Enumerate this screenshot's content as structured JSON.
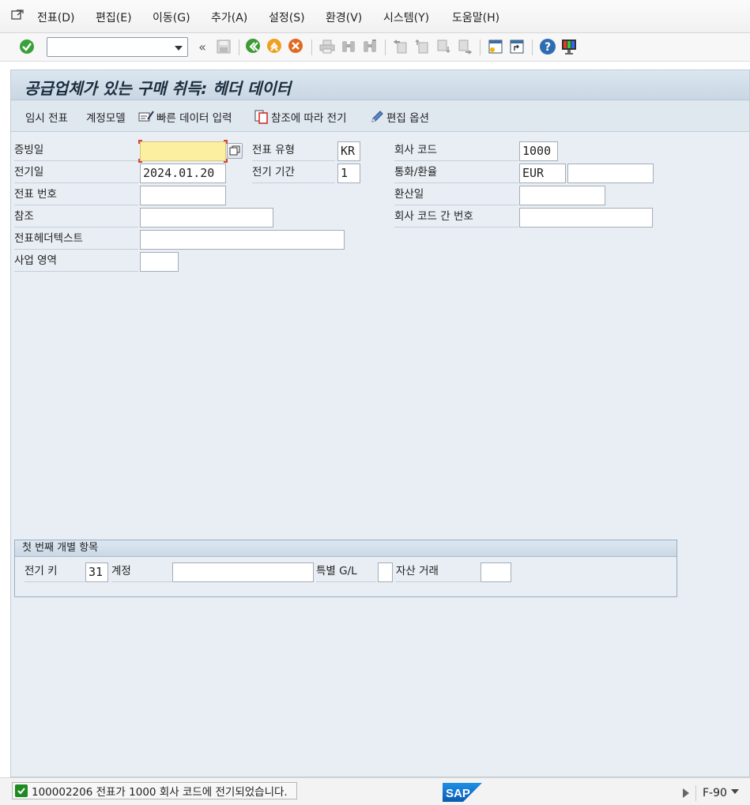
{
  "menu": {
    "items": [
      "전표(D)",
      "편집(E)",
      "이동(G)",
      "추가(A)",
      "설정(S)",
      "환경(V)",
      "시스템(Y)",
      "도움말(H)"
    ]
  },
  "toolbar": {
    "command_value": "",
    "icons": [
      "enter-icon",
      "back-icon",
      "save-icon",
      "back-green-icon",
      "exit-icon",
      "cancel-icon",
      "print-icon",
      "find-icon",
      "find-next-icon",
      "first-page-icon",
      "prev-page-icon",
      "next-page-icon",
      "last-page-icon",
      "new-session-icon",
      "shortcut-icon",
      "help-icon",
      "customize-layout-icon"
    ]
  },
  "screen": {
    "title": "공급업체가 있는 구매 취득: 헤더 데이터"
  },
  "app_toolbar": {
    "buttons": [
      "임시 전표",
      "계정모델",
      "빠른 데이터 입력",
      "참조에 따라 전기",
      "편집 옵션"
    ]
  },
  "header": {
    "doc_date_label": "증빙일",
    "doc_date_value": "",
    "posting_date_label": "전기일",
    "posting_date_value": "2024.01.20",
    "doc_number_label": "전표 번호",
    "doc_number_value": "",
    "reference_label": "참조",
    "reference_value": "",
    "header_text_label": "전표헤더텍스트",
    "header_text_value": "",
    "business_area_label": "사업 영역",
    "business_area_value": "",
    "doc_type_label": "전표 유형",
    "doc_type_value": "KR",
    "period_label": "전기 기간",
    "period_value": "1",
    "company_code_label": "회사 코드",
    "company_code_value": "1000",
    "currency_label": "통화/환율",
    "currency_value": "EUR",
    "exchange_rate_value": "",
    "translation_date_label": "환산일",
    "translation_date_value": "",
    "intercompany_label": "회사 코드 간 번호",
    "intercompany_value": ""
  },
  "first_item": {
    "group_title": "첫 번째 개별 항목",
    "posting_key_label": "전기 키",
    "posting_key_value": "31",
    "account_label": "계정",
    "account_value": "",
    "special_gl_label": "특별 G/L",
    "special_gl_value": "",
    "asset_tx_label": "자산 거래",
    "asset_tx_value": ""
  },
  "status": {
    "message": "100002206 전표가 1000 회사 코드에 전기되었습니다.",
    "logo": "SAP",
    "transaction": "F-90"
  },
  "colors": {
    "required_field": "#fcefa0",
    "title_bg": "#cad8e4",
    "status_ok": "#1f8a22"
  }
}
